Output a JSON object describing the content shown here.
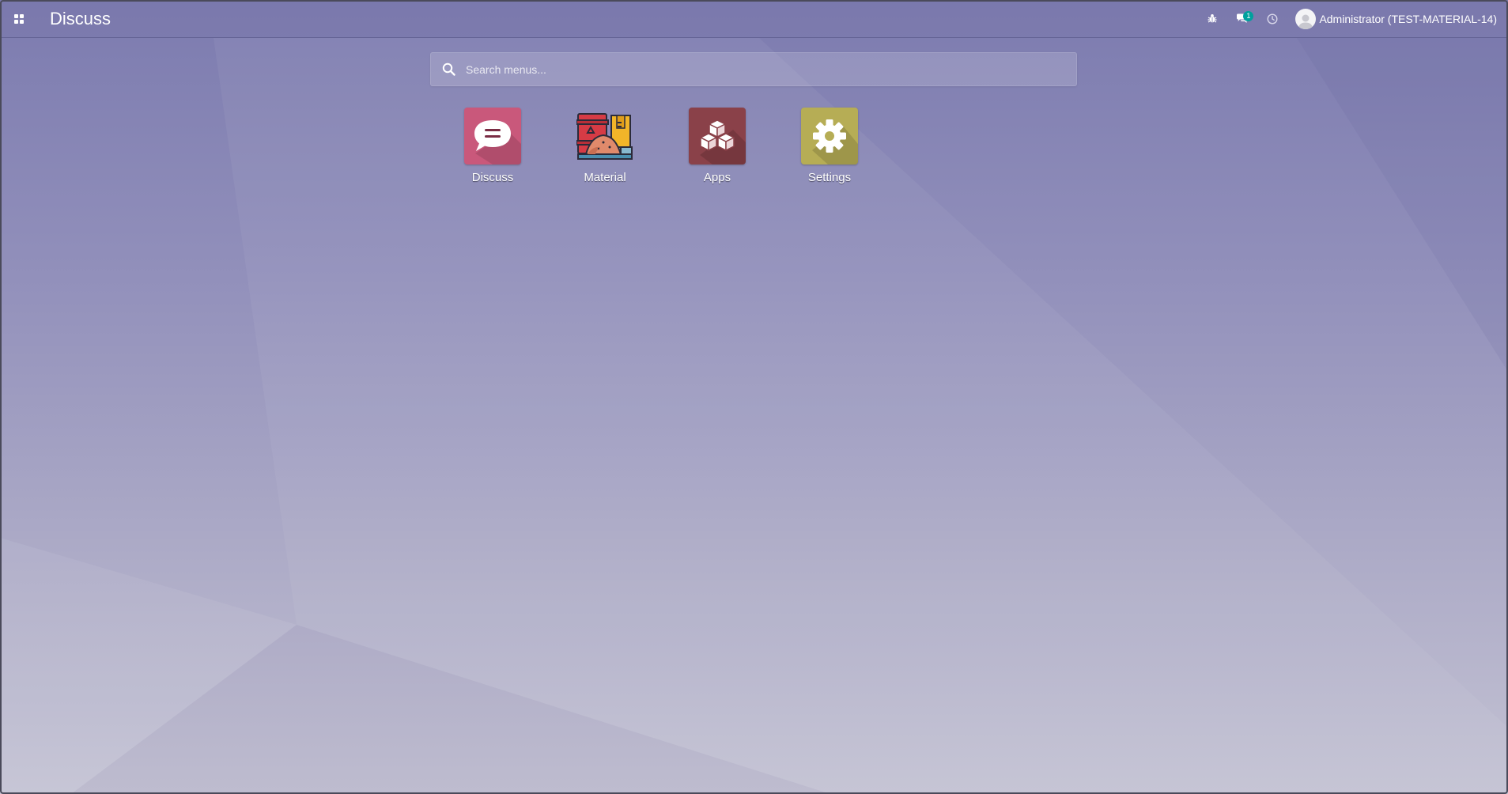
{
  "navbar": {
    "apps_toggle_icon": "apps-grid-icon",
    "brand": "Discuss",
    "debug_icon": "bug-icon",
    "messaging_icon": "comments-icon",
    "message_count": "1",
    "activity_icon": "clock-icon",
    "user_name": "Administrator (TEST-MATERIAL-14)"
  },
  "search": {
    "placeholder": "Search menus..."
  },
  "apps": [
    {
      "label": "Discuss",
      "icon": "speech-bubble-icon",
      "color": "#c9587b"
    },
    {
      "label": "Material",
      "icon": "material-warehouse-icon",
      "color": "#d63b45"
    },
    {
      "label": "Apps",
      "icon": "cubes-icon",
      "color": "#8a4149"
    },
    {
      "label": "Settings",
      "icon": "gear-icon",
      "color": "#b6ad55"
    }
  ],
  "colors": {
    "badge": "#00a09d",
    "background_top": "#7c7baf",
    "background_bottom": "#c3c2d3"
  }
}
